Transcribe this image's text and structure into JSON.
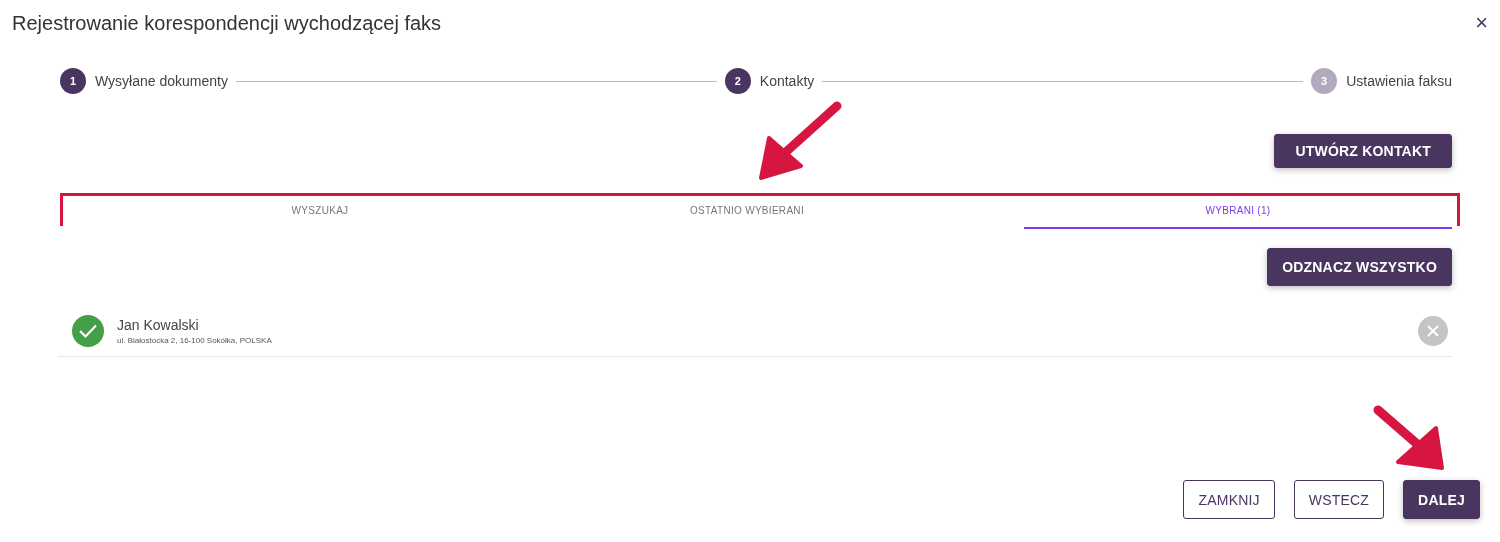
{
  "window": {
    "title": "Rejestrowanie korespondencji wychodzącej faks",
    "close": "×"
  },
  "steps": [
    {
      "number": "1",
      "label": "Wysyłane dokumenty",
      "reached": true
    },
    {
      "number": "2",
      "label": "Kontakty",
      "reached": true
    },
    {
      "number": "3",
      "label": "Ustawienia faksu",
      "reached": false
    }
  ],
  "create_button": "UTWÓRZ KONTAKT",
  "tabs": [
    {
      "label": "WYSZUKAJ",
      "selected": false
    },
    {
      "label": "OSTATNIO WYBIERANI",
      "selected": false
    },
    {
      "label": "WYBRANI (1)",
      "selected": true
    }
  ],
  "clear_button": "ODZNACZ WSZYSTKO",
  "contacts": [
    {
      "name": "Jan Kowalski",
      "address": "ul. Białostocka 2, 16-100 Sokółka, POLSKA",
      "checked": true
    }
  ],
  "footer_buttons": [
    {
      "label": "ZAMKNIJ",
      "kind": "outline"
    },
    {
      "label": "WSTECZ",
      "kind": "outline"
    },
    {
      "label": "DALEJ",
      "kind": "primary"
    }
  ]
}
